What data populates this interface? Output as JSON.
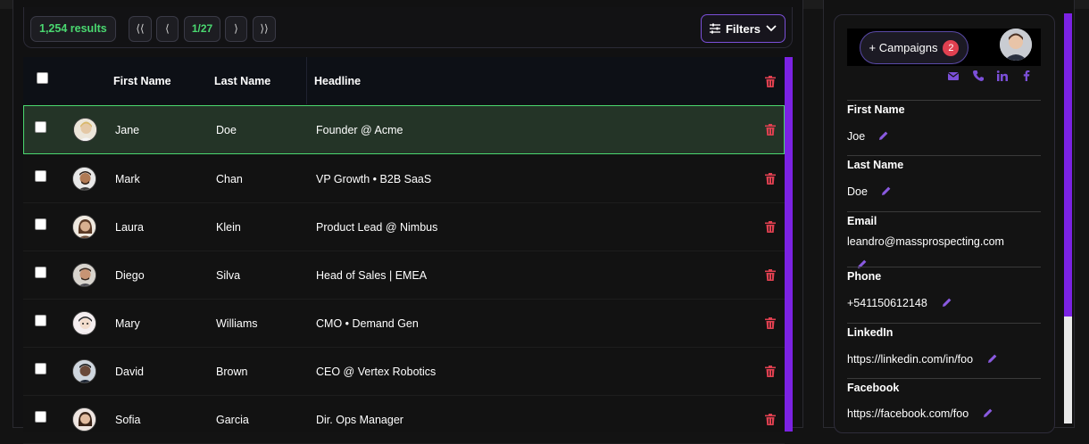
{
  "toolbar": {
    "results_count": "1,254 results",
    "first_page": "⟨⟨",
    "prev_page": "⟨",
    "page_indicator": "1/27",
    "next_page": "⟩",
    "last_page": "⟩⟩",
    "filters_label": "Filters"
  },
  "table": {
    "headers": {
      "first_name": "First Name",
      "last_name": "Last Name",
      "headline": "Headline"
    },
    "rows": [
      {
        "first": "Jane",
        "last": "Doe",
        "headline": "Founder @ Acme",
        "selected": true
      },
      {
        "first": "Mark",
        "last": "Chan",
        "headline": "VP Growth • B2B SaaS"
      },
      {
        "first": "Laura",
        "last": "Klein",
        "headline": "Product Lead @ Nimbus"
      },
      {
        "first": "Diego",
        "last": "Silva",
        "headline": "Head of Sales | EMEA"
      },
      {
        "first": "Mary",
        "last": "Williams",
        "headline": "CMO • Demand Gen"
      },
      {
        "first": "David",
        "last": "Brown",
        "headline": "CEO @ Vertex Robotics"
      },
      {
        "first": "Sofia",
        "last": "Garcia",
        "headline": "Dir. Ops Manager"
      }
    ]
  },
  "profile": {
    "campaigns_label": "+ Campaigns",
    "campaigns_count": "2",
    "fields": {
      "first_name_label": "First Name",
      "first_name_value": "Joe",
      "last_name_label": "Last Name",
      "last_name_value": "Doe",
      "email_label": "Email",
      "email_value": "leandro@massprospecting.com",
      "phone_label": "Phone",
      "phone_value": "+541150612148",
      "linkedin_label": "LinkedIn",
      "linkedin_value": "https://linkedin.com/in/foo",
      "facebook_label": "Facebook",
      "facebook_value": "https://facebook.com/foo"
    }
  },
  "colors": {
    "accent_purple": "#7b22e3",
    "green": "#4ad870",
    "danger": "#e04050"
  }
}
